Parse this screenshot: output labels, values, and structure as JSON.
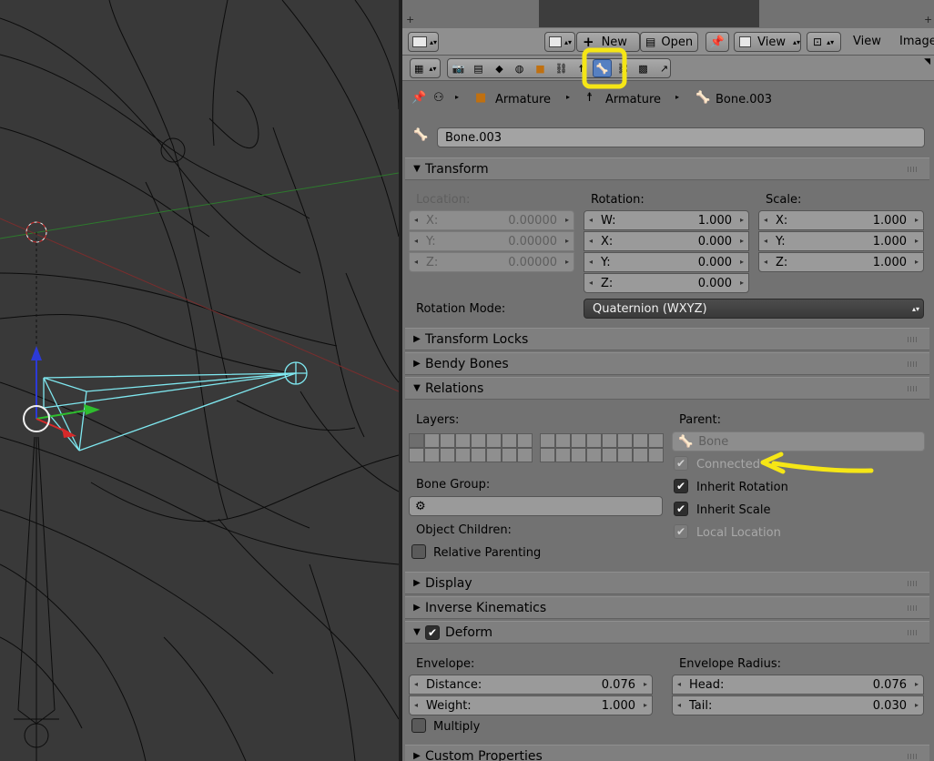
{
  "header": {
    "view": "View",
    "image": "Image",
    "new": "New",
    "open": "Open",
    "view2": "View"
  },
  "breadcrumb": {
    "object": "Armature",
    "data": "Armature",
    "bone": "Bone.003"
  },
  "bone_name": "Bone.003",
  "transform": {
    "title": "Transform",
    "location_label": "Location:",
    "rotation_label": "Rotation:",
    "scale_label": "Scale:",
    "location": [
      {
        "axis": "X:",
        "value": "0.00000"
      },
      {
        "axis": "Y:",
        "value": "0.00000"
      },
      {
        "axis": "Z:",
        "value": "0.00000"
      }
    ],
    "rotation": [
      {
        "axis": "W:",
        "value": "1.000"
      },
      {
        "axis": "X:",
        "value": "0.000"
      },
      {
        "axis": "Y:",
        "value": "0.000"
      },
      {
        "axis": "Z:",
        "value": "0.000"
      }
    ],
    "scale": [
      {
        "axis": "X:",
        "value": "1.000"
      },
      {
        "axis": "Y:",
        "value": "1.000"
      },
      {
        "axis": "Z:",
        "value": "1.000"
      }
    ],
    "rotation_mode_label": "Rotation Mode:",
    "rotation_mode": "Quaternion (WXYZ)"
  },
  "sections": {
    "transform_locks": "Transform Locks",
    "bendy_bones": "Bendy Bones",
    "relations": "Relations",
    "display": "Display",
    "inverse_kinematics": "Inverse Kinematics",
    "deform": "Deform",
    "custom_properties": "Custom Properties"
  },
  "relations": {
    "layers_label": "Layers:",
    "parent_label": "Parent:",
    "parent_value": "Bone",
    "connected": "Connected",
    "inherit_rotation": "Inherit Rotation",
    "inherit_scale": "Inherit Scale",
    "local_location": "Local Location",
    "bone_group_label": "Bone Group:",
    "object_children_label": "Object Children:",
    "relative_parenting": "Relative Parenting"
  },
  "deform": {
    "envelope_label": "Envelope:",
    "envelope_radius_label": "Envelope Radius:",
    "distance_label": "Distance:",
    "distance": "0.076",
    "weight_label": "Weight:",
    "weight": "1.000",
    "head_label": "Head:",
    "head": "0.076",
    "tail_label": "Tail:",
    "tail": "0.030",
    "multiply": "Multiply"
  },
  "colors": {
    "highlight": "#f5e616",
    "active_tab": "#5680c2",
    "bone_wire": "#7fe8f0"
  }
}
